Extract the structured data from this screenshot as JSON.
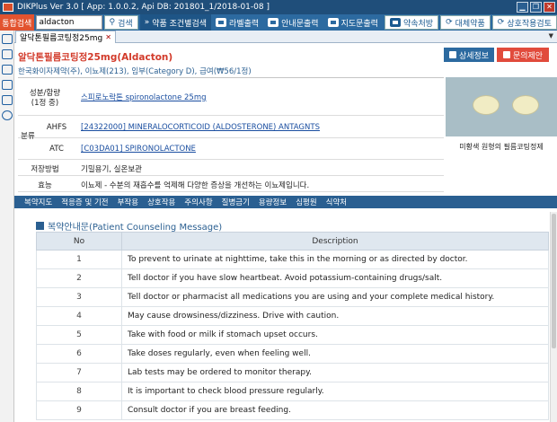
{
  "window": {
    "title": "DIKPlus Ver 3.0 [ App: 1.0.0.2, Api DB: 201801_1/2018-01-08 ]",
    "minimize": "▁",
    "restore": "❐",
    "close": "✕"
  },
  "toolbar": {
    "integrated_search": "통합검색",
    "search_value": "aldacton",
    "search_button": "검색",
    "condition_search": "약품 조건별검색",
    "label_print": "라벨출력",
    "guide_print": "안내문출력",
    "instruction_print": "지도문출력",
    "promise_prescription": "약속처방",
    "substitute": "대체약품",
    "interaction": "상호작용검토"
  },
  "tab": {
    "label": "알닥톤필름코팅정25mg",
    "close": "✕"
  },
  "drug": {
    "name": "알닥톤필름코팅정25mg(Aldacton)",
    "maker_line": "한국화이자제약(주), 이뇨제(213), 임부(Category D), 급여(₩56/1정)",
    "detail_button": "상세정보",
    "inquiry_button": "문의제안"
  },
  "info": {
    "ingredient_label": "성분/함량",
    "ingredient_count": "(1정 중)",
    "ingredient_value": "스피로노락톤 spironolactone 25mg",
    "class_label": "분류",
    "ahfs_label": "AHFS",
    "ahfs_value": "[24322000] MINERALOCORTICOID (ALDOSTERONE) ANTAGNTS",
    "atc_label": "ATC",
    "atc_value": "[C03DA01] SPIRONOLACTONE",
    "storage_label": "저장방법",
    "storage_value": "기밀용기, 실온보관",
    "efficacy_label": "효능",
    "efficacy_value": "이뇨제 - 수분의 재흡수를 억제해 다양한 증상을 개선하는 이뇨제입니다.",
    "pill_description": "미황색 원형의 필름코팅정제"
  },
  "section_tabs": [
    "복약지도",
    "적응증 및 기전",
    "부작용",
    "상호작용",
    "주의사항",
    "질병금기",
    "용량정보",
    "심평원",
    "식약처"
  ],
  "counseling": {
    "title": "복약안내문(Patient Counseling Message)",
    "headers": [
      "No",
      "Description"
    ],
    "rows": [
      {
        "no": "1",
        "desc": "To prevent to urinate at nighttime, take this in the morning or as directed by doctor."
      },
      {
        "no": "2",
        "desc": "Tell doctor if you have slow heartbeat. Avoid potassium-containing drugs/salt."
      },
      {
        "no": "3",
        "desc": "Tell doctor or pharmacist all medications you are using and your complete medical history."
      },
      {
        "no": "4",
        "desc": "May cause drowsiness/dizziness. Drive with caution."
      },
      {
        "no": "5",
        "desc": "Take with food or milk if stomach upset occurs."
      },
      {
        "no": "6",
        "desc": "Take doses regularly, even when feeling well."
      },
      {
        "no": "7",
        "desc": "Lab tests may be ordered to monitor therapy."
      },
      {
        "no": "8",
        "desc": "It is important to check blood pressure regularly."
      },
      {
        "no": "9",
        "desc": "Consult doctor if you are breast feeding."
      }
    ]
  },
  "colors": {
    "titlebar": "#1f4e7a",
    "toolbar": "#2c6aa0",
    "accent_red": "#d23a2a",
    "link_blue": "#1a4ea0"
  },
  "icons": [
    "menu-icon",
    "home-icon",
    "document-icon",
    "pill-icon",
    "monitor-icon",
    "gear-icon"
  ]
}
